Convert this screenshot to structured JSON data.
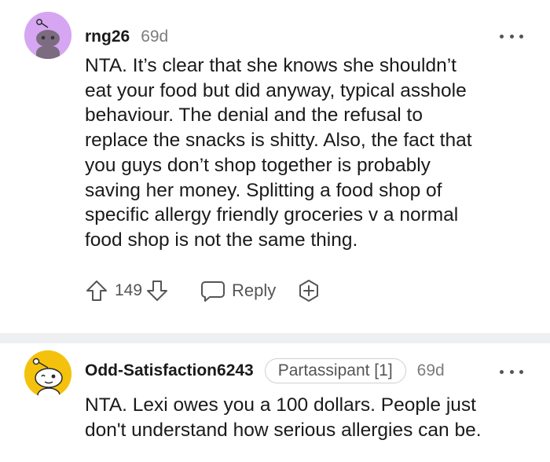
{
  "comments": [
    {
      "username": "rng26",
      "age": "69d",
      "body_lines": [
        "NTA. It’s clear that she knows she shouldn’t",
        "eat your food but did anyway, typical asshole",
        "behaviour. The denial and the refusal to",
        "replace the snacks is shitty. Also, the fact that",
        "you guys don’t shop together is probably",
        "saving her money. Splitting a food shop of",
        "specific allergy friendly groceries v a normal",
        "food shop is not the same thing."
      ],
      "score": "149",
      "reply_label": "Reply",
      "avatar_color": "#d6a6f2",
      "icons": {
        "upvote": "upvote-arrow-icon",
        "downvote": "downvote-arrow-icon",
        "reply": "speech-bubble-icon",
        "award": "award-plus-icon",
        "more": "more-dots-icon"
      }
    },
    {
      "username": "Odd-Satisfaction6243",
      "flair": "Partassipant [1]",
      "age": "69d",
      "body_lines": [
        "NTA. Lexi owes you a 100 dollars. People just",
        "don't understand how serious allergies can be."
      ],
      "avatar_color": "#f4c20d"
    }
  ],
  "colors": {
    "text": "#1a1a1b",
    "meta": "#7c7c7c",
    "icon": "#555555",
    "divider": "#edeff1"
  }
}
